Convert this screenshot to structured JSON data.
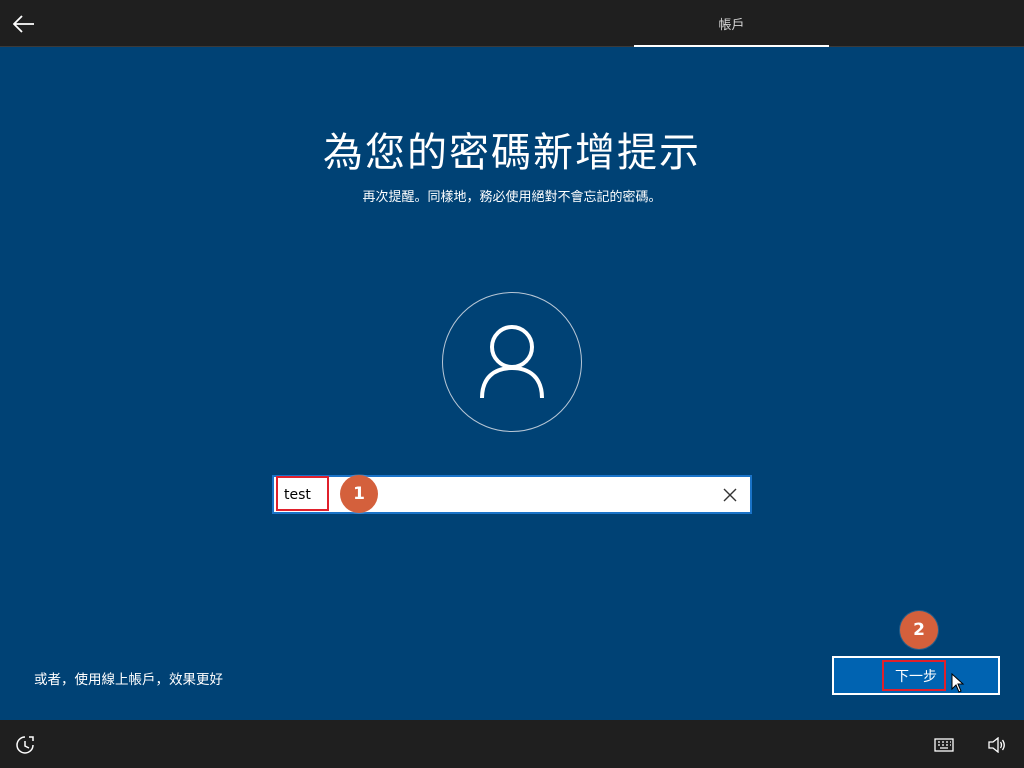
{
  "header": {
    "tab_label": "帳戶"
  },
  "main": {
    "title": "為您的密碼新增提示",
    "subtitle": "再次提醒。同樣地，務必使用絕對不會忘記的密碼。",
    "hint_input": {
      "value": "test",
      "placeholder": ""
    },
    "online_link": "或者，使用線上帳戶，效果更好",
    "next_label": "下一步"
  },
  "annotations": {
    "badge_1": "1",
    "badge_2": "2"
  },
  "icons": {
    "back": "back-arrow-icon",
    "avatar": "user-icon",
    "clear": "close-icon",
    "ease_of_access": "ease-of-access-icon",
    "keyboard": "keyboard-icon",
    "volume": "volume-icon"
  },
  "colors": {
    "background": "#004275",
    "bars": "#1f1f1f",
    "button": "#0063b1",
    "badge": "#d4603c",
    "highlight": "#e0202b"
  }
}
